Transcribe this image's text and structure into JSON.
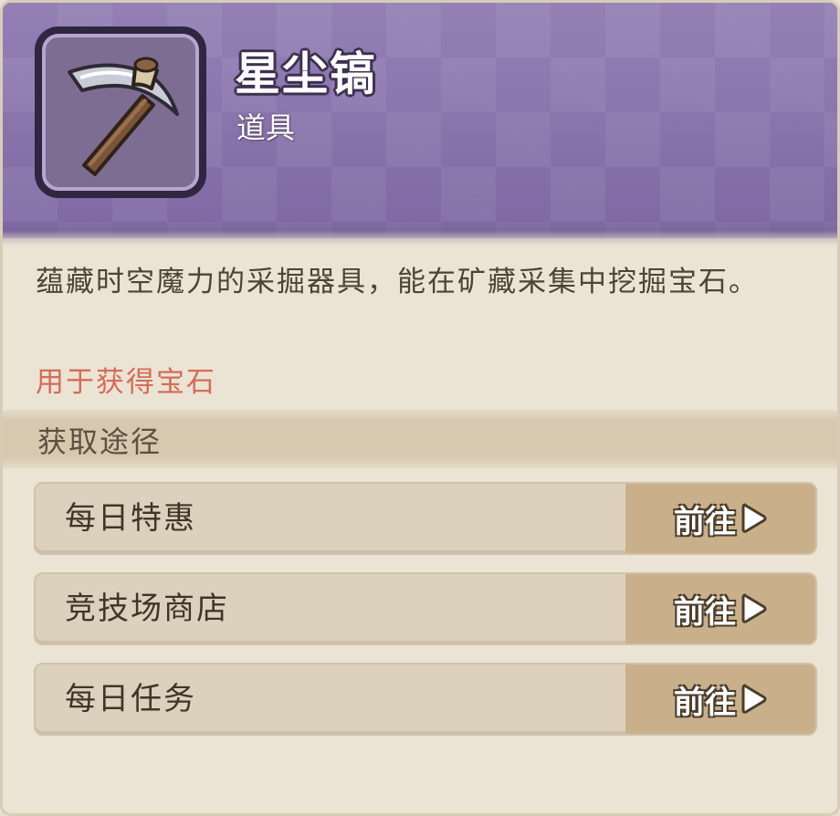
{
  "item": {
    "name": "星尘镐",
    "type": "道具",
    "icon": "pickaxe-icon",
    "description": "蕴藏时空魔力的采掘器具，能在矿藏采集中挖掘宝石。",
    "usage": "用于获得宝石"
  },
  "sources": {
    "title": "获取途径",
    "rows": [
      {
        "label": "每日特惠",
        "action": "前往"
      },
      {
        "label": "竞技场商店",
        "action": "前往"
      },
      {
        "label": "每日任务",
        "action": "前往"
      }
    ]
  },
  "colors": {
    "header": "#8a72ab",
    "usage_text": "#d46c59",
    "button": "#c9b08a"
  }
}
